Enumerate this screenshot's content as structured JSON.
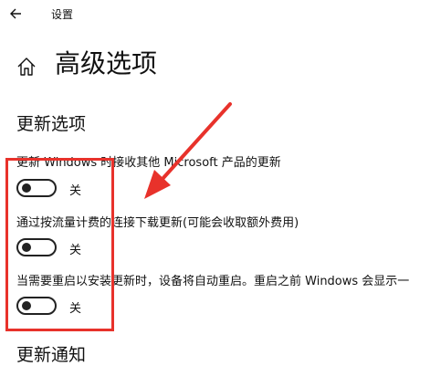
{
  "window": {
    "title": "设置"
  },
  "page": {
    "title": "高级选项"
  },
  "update_options": {
    "heading": "更新选项",
    "settings": [
      {
        "label": "更新 Windows 时接收其他 Microsoft 产品的更新",
        "state": "关",
        "on": false
      },
      {
        "label": "通过按流量计费的连接下载更新(可能会收取额外费用)",
        "state": "关",
        "on": false
      },
      {
        "label": "当需要重启以安装更新时，设备将自动重启。重启之前 Windows 会显示一",
        "state": "关",
        "on": false
      }
    ]
  },
  "update_notifications": {
    "heading": "更新通知"
  },
  "icons": {
    "back": "back-arrow-icon",
    "home": "home-icon"
  },
  "colors": {
    "annotation": "#e8322b",
    "toggle_off": "#222222",
    "background": "#ffffff"
  }
}
